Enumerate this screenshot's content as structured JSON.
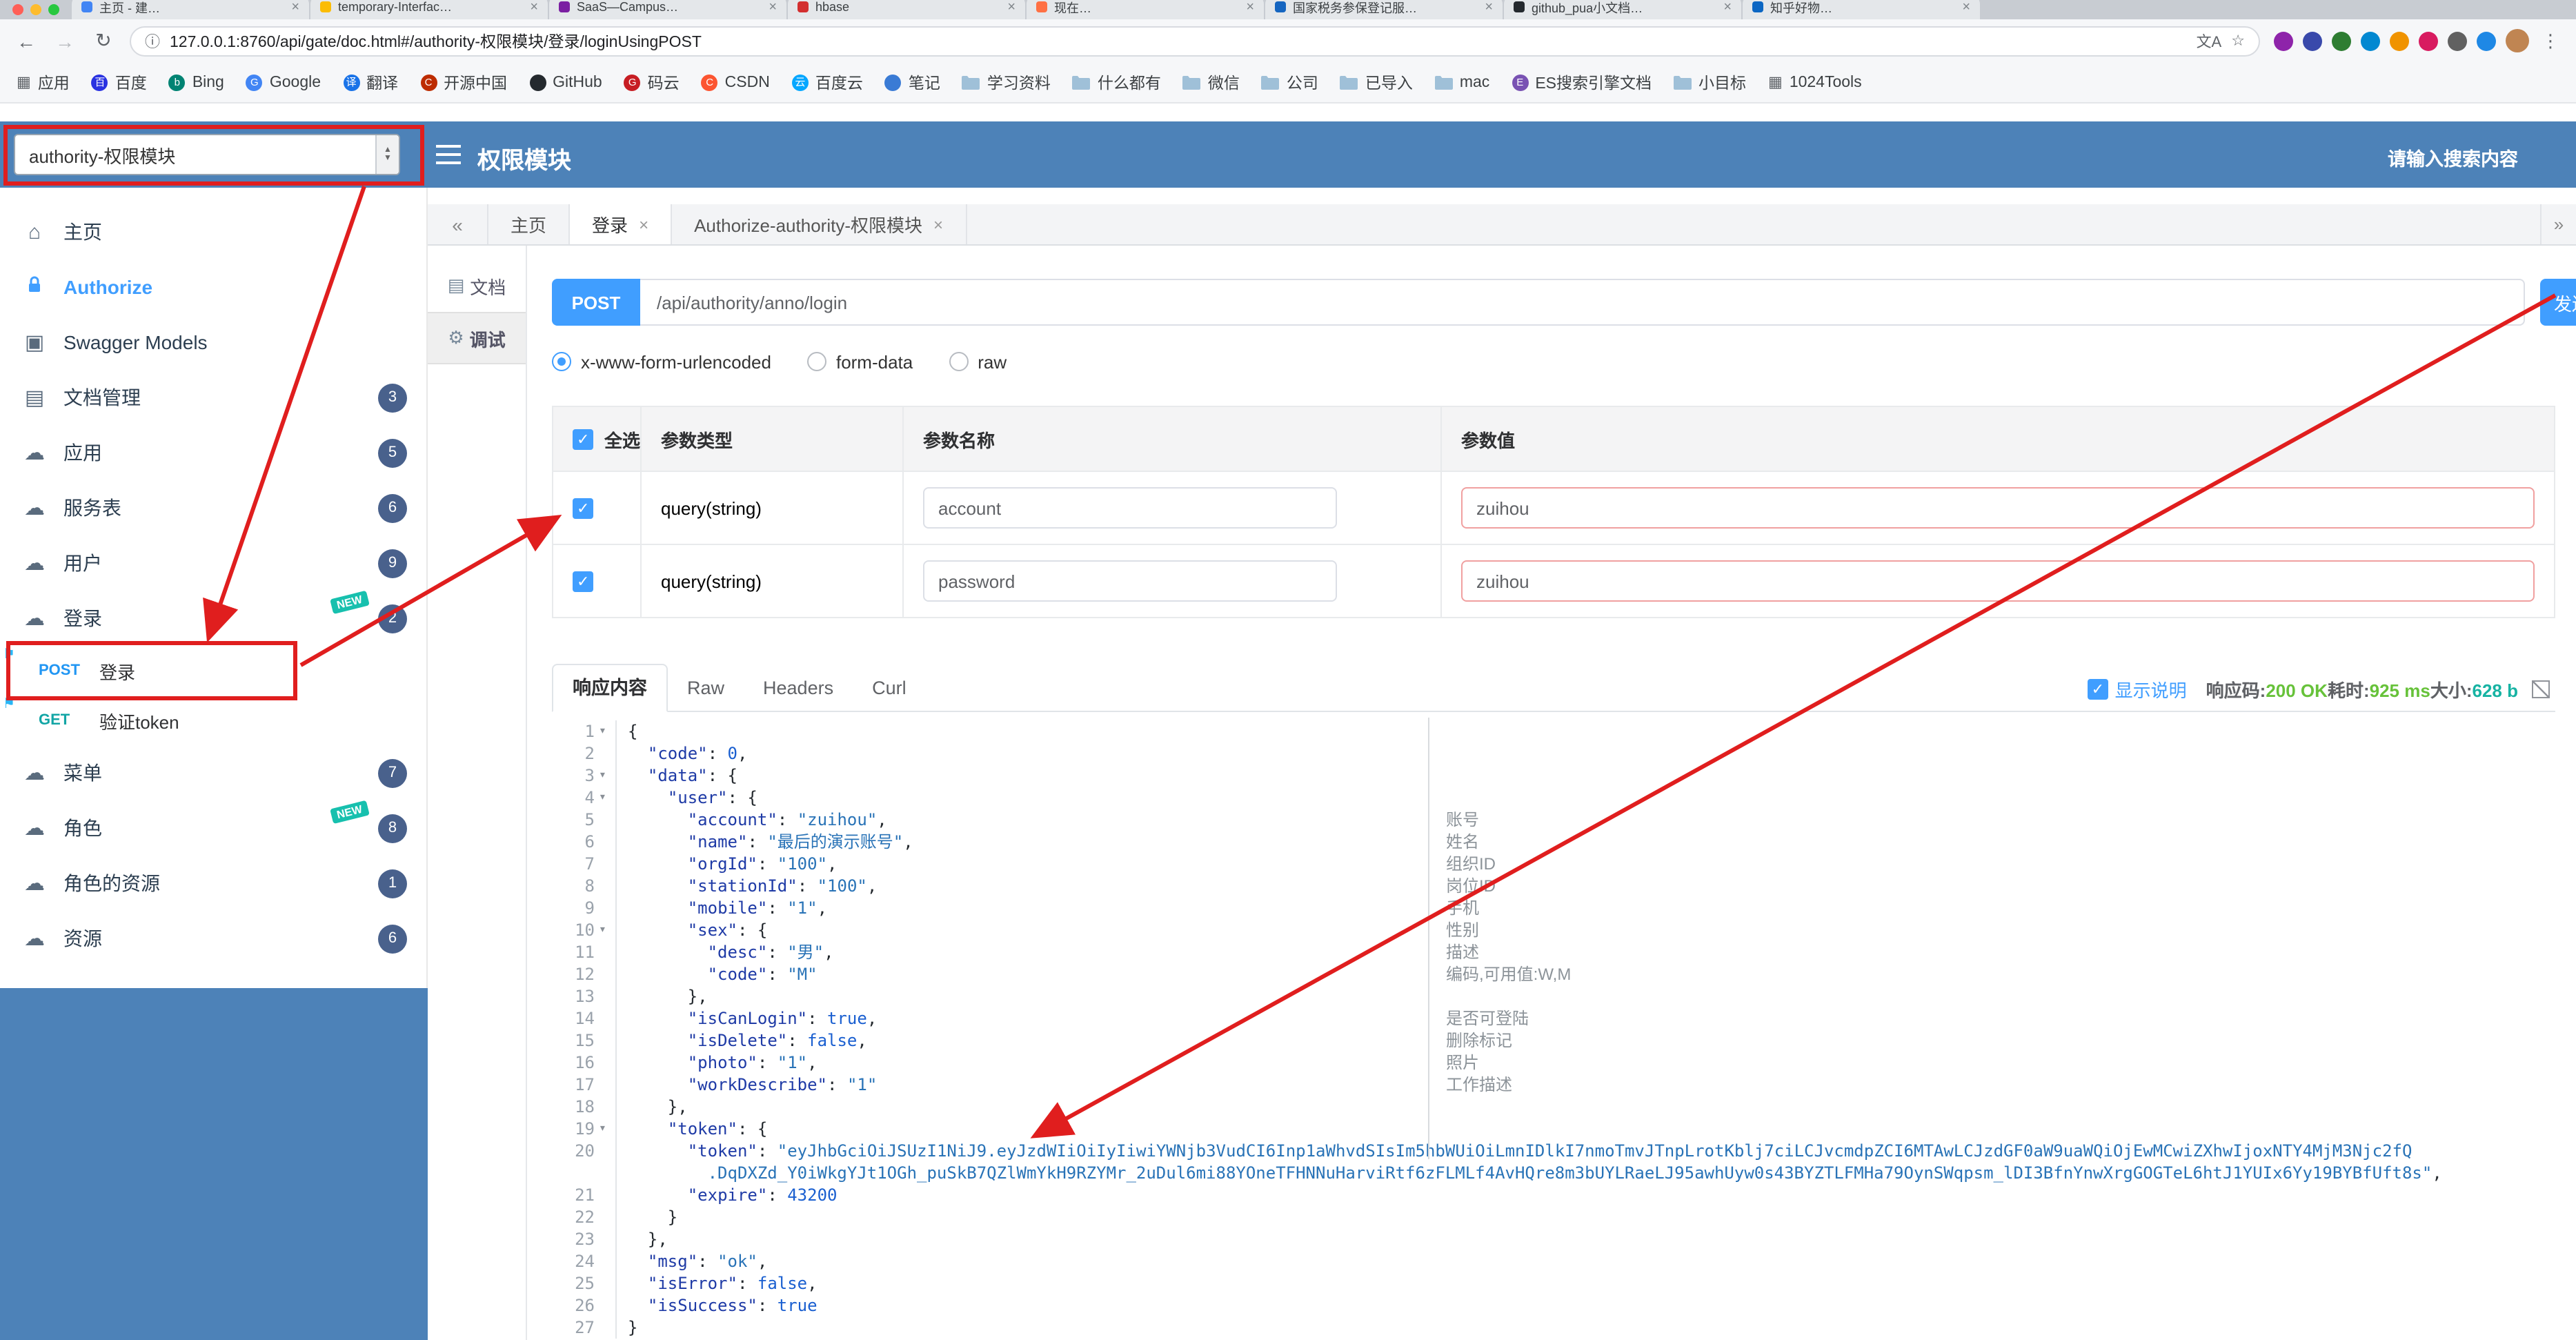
{
  "browser": {
    "traffic_lights": [
      "#ff5f57",
      "#febc2e",
      "#28c840"
    ],
    "tabs": [
      {
        "label": "主页 - 建…",
        "favicon": "#4285f4"
      },
      {
        "label": "temporary-Interfac…",
        "favicon": "#fbbc04"
      },
      {
        "label": "SaaS—Campus…",
        "favicon": "#7b1fa2"
      },
      {
        "label": "hbase",
        "favicon": "#d32f2f"
      },
      {
        "label": "现在…",
        "favicon": "#ff7043"
      },
      {
        "label": "国家税务参保登记服…",
        "favicon": "#1565c0"
      },
      {
        "label": "github_pua小文档…",
        "favicon": "#24292e"
      },
      {
        "label": "知乎好物…",
        "favicon": "#0b66c3"
      }
    ],
    "url": "127.0.0.1:8760/api/gate/doc.html#/authority-权限模块/登录/loginUsingPOST",
    "extensions": [
      {
        "name": "extension-icon",
        "color": "#8e24aa"
      },
      {
        "name": "extension-icon",
        "color": "#3949ab"
      },
      {
        "name": "extension-icon",
        "color": "#2e7d32"
      },
      {
        "name": "extension-icon",
        "color": "#0288d1"
      },
      {
        "name": "extension-icon",
        "color": "#f09300"
      },
      {
        "name": "extension-icon",
        "color": "#d81b60"
      },
      {
        "name": "extension-icon",
        "color": "#616161"
      },
      {
        "name": "extension-icon",
        "color": "#1e88e5"
      }
    ],
    "bookmarks": [
      {
        "label": "应用",
        "type": "apps"
      },
      {
        "label": "百度",
        "type": "site",
        "color": "#2932e1",
        "letter": "百"
      },
      {
        "label": "Bing",
        "type": "site",
        "color": "#008373",
        "letter": "b"
      },
      {
        "label": "Google",
        "type": "site",
        "color": "#4285f4",
        "letter": "G"
      },
      {
        "label": "翻译",
        "type": "site",
        "color": "#1a73e8",
        "letter": "译"
      },
      {
        "label": "开源中国",
        "type": "site",
        "color": "#bd2c00",
        "letter": "C"
      },
      {
        "label": "GitHub",
        "type": "site",
        "color": "#24292e",
        "letter": ""
      },
      {
        "label": "码云",
        "type": "site",
        "color": "#c71d23",
        "letter": "G"
      },
      {
        "label": "CSDN",
        "type": "site",
        "color": "#fc5531",
        "letter": "C"
      },
      {
        "label": "百度云",
        "type": "site",
        "color": "#06a7ff",
        "letter": "云"
      },
      {
        "label": "笔记",
        "type": "site",
        "color": "#3a7bd5",
        "letter": ""
      },
      {
        "label": "学习资料",
        "type": "folder"
      },
      {
        "label": "什么都有",
        "type": "folder"
      },
      {
        "label": "微信",
        "type": "folder"
      },
      {
        "label": "公司",
        "type": "folder"
      },
      {
        "label": "已导入",
        "type": "folder"
      },
      {
        "label": "mac",
        "type": "folder"
      },
      {
        "label": "ES搜索引擎文档",
        "type": "site",
        "color": "#7952b3",
        "letter": "E"
      },
      {
        "label": "小目标",
        "type": "folder"
      },
      {
        "label": "1024Tools",
        "type": "apps"
      }
    ]
  },
  "header": {
    "module_select": "authority-权限模块",
    "title": "权限模块",
    "search_placeholder": "请输入搜索内容"
  },
  "sidebar": {
    "items": [
      {
        "label": "主页",
        "icon": "home"
      },
      {
        "label": "Authorize",
        "icon": "lock"
      },
      {
        "label": "Swagger Models",
        "icon": "models"
      },
      {
        "label": "文档管理",
        "icon": "doc",
        "badge": "3"
      },
      {
        "label": "应用",
        "icon": "cloud",
        "badge": "5"
      },
      {
        "label": "服务表",
        "icon": "cloud",
        "badge": "6"
      },
      {
        "label": "用户",
        "icon": "cloud",
        "badge": "9"
      },
      {
        "label": "登录",
        "icon": "cloud",
        "badge": "2",
        "new": true
      },
      {
        "label": "菜单",
        "icon": "cloud",
        "badge": "7"
      },
      {
        "label": "角色",
        "icon": "cloud",
        "badge": "8",
        "new": true
      },
      {
        "label": "角色的资源",
        "icon": "cloud",
        "badge": "1"
      },
      {
        "label": "资源",
        "icon": "cloud",
        "badge": "6"
      }
    ],
    "sub_items": [
      {
        "method": "POST",
        "label": "登录"
      },
      {
        "method": "GET",
        "label": "验证token"
      }
    ]
  },
  "doc_tabs": {
    "collapse": "«",
    "expand": "»",
    "tabs": [
      {
        "label": "主页"
      },
      {
        "label": "登录"
      },
      {
        "label": "Authorize-authority-权限模块"
      }
    ]
  },
  "minitabs": {
    "doc": "文档",
    "debug": "调试"
  },
  "request": {
    "method": "POST",
    "url": "/api/authority/anno/login",
    "send_label": "发送",
    "content_types": [
      "x-www-form-urlencoded",
      "form-data",
      "raw"
    ],
    "selected_content_type": "x-www-form-urlencoded",
    "table": {
      "headers": [
        "全选",
        "参数类型",
        "参数名称",
        "参数值"
      ],
      "rows": [
        {
          "checked": true,
          "type": "query(string)",
          "name": "account",
          "value": "zuihou"
        },
        {
          "checked": true,
          "type": "query(string)",
          "name": "password",
          "value": "zuihou"
        }
      ]
    }
  },
  "response": {
    "tabs": [
      "响应内容",
      "Raw",
      "Headers",
      "Curl"
    ],
    "active_tab": "响应内容",
    "show_desc": "显示说明",
    "meta": [
      {
        "label": "响应码:",
        "value": "200 OK",
        "color": "#67c23a"
      },
      {
        "label": "耗时:",
        "value": "925 ms",
        "color": "#67c23a"
      },
      {
        "label": "大小:",
        "value": "628 b",
        "color": "#17b3a3"
      }
    ],
    "code_lines": [
      {
        "n": "1",
        "fold": true,
        "parts": [
          [
            "p",
            "{"
          ]
        ]
      },
      {
        "n": "2",
        "parts": [
          [
            "p",
            "  "
          ],
          [
            "k",
            "\"code\""
          ],
          [
            "p",
            ": "
          ],
          [
            "n",
            "0"
          ],
          [
            "p",
            ","
          ]
        ]
      },
      {
        "n": "3",
        "fold": true,
        "parts": [
          [
            "p",
            "  "
          ],
          [
            "k",
            "\"data\""
          ],
          [
            "p",
            ": {"
          ]
        ]
      },
      {
        "n": "4",
        "fold": true,
        "parts": [
          [
            "p",
            "    "
          ],
          [
            "k",
            "\"user\""
          ],
          [
            "p",
            ": {"
          ]
        ]
      },
      {
        "n": "5",
        "note": "账号",
        "parts": [
          [
            "p",
            "      "
          ],
          [
            "k",
            "\"account\""
          ],
          [
            "p",
            ": "
          ],
          [
            "s",
            "\"zuihou\""
          ],
          [
            "p",
            ","
          ]
        ]
      },
      {
        "n": "6",
        "note": "姓名",
        "parts": [
          [
            "p",
            "      "
          ],
          [
            "k",
            "\"name\""
          ],
          [
            "p",
            ": "
          ],
          [
            "s",
            "\"最后的演示账号\""
          ],
          [
            "p",
            ","
          ]
        ]
      },
      {
        "n": "7",
        "note": "组织ID",
        "parts": [
          [
            "p",
            "      "
          ],
          [
            "k",
            "\"orgId\""
          ],
          [
            "p",
            ": "
          ],
          [
            "s",
            "\"100\""
          ],
          [
            "p",
            ","
          ]
        ]
      },
      {
        "n": "8",
        "note": "岗位ID",
        "parts": [
          [
            "p",
            "      "
          ],
          [
            "k",
            "\"stationId\""
          ],
          [
            "p",
            ": "
          ],
          [
            "s",
            "\"100\""
          ],
          [
            "p",
            ","
          ]
        ]
      },
      {
        "n": "9",
        "note": "手机",
        "parts": [
          [
            "p",
            "      "
          ],
          [
            "k",
            "\"mobile\""
          ],
          [
            "p",
            ": "
          ],
          [
            "s",
            "\"1\""
          ],
          [
            "p",
            ","
          ]
        ]
      },
      {
        "n": "10",
        "fold": true,
        "note": "性别",
        "parts": [
          [
            "p",
            "      "
          ],
          [
            "k",
            "\"sex\""
          ],
          [
            "p",
            ": {"
          ]
        ]
      },
      {
        "n": "11",
        "note": "描述",
        "parts": [
          [
            "p",
            "        "
          ],
          [
            "k",
            "\"desc\""
          ],
          [
            "p",
            ": "
          ],
          [
            "s",
            "\"男\""
          ],
          [
            "p",
            ","
          ]
        ]
      },
      {
        "n": "12",
        "note": "编码,可用值:W,M",
        "parts": [
          [
            "p",
            "        "
          ],
          [
            "k",
            "\"code\""
          ],
          [
            "p",
            ": "
          ],
          [
            "s",
            "\"M\""
          ]
        ]
      },
      {
        "n": "13",
        "parts": [
          [
            "p",
            "      },"
          ]
        ]
      },
      {
        "n": "14",
        "note": "是否可登陆",
        "parts": [
          [
            "p",
            "      "
          ],
          [
            "k",
            "\"isCanLogin\""
          ],
          [
            "p",
            ": "
          ],
          [
            "n",
            "true"
          ],
          [
            "p",
            ","
          ]
        ]
      },
      {
        "n": "15",
        "note": "删除标记",
        "parts": [
          [
            "p",
            "      "
          ],
          [
            "k",
            "\"isDelete\""
          ],
          [
            "p",
            ": "
          ],
          [
            "n",
            "false"
          ],
          [
            "p",
            ","
          ]
        ]
      },
      {
        "n": "16",
        "note": "照片",
        "parts": [
          [
            "p",
            "      "
          ],
          [
            "k",
            "\"photo\""
          ],
          [
            "p",
            ": "
          ],
          [
            "s",
            "\"1\""
          ],
          [
            "p",
            ","
          ]
        ]
      },
      {
        "n": "17",
        "note": "工作描述",
        "parts": [
          [
            "p",
            "      "
          ],
          [
            "k",
            "\"workDescribe\""
          ],
          [
            "p",
            ": "
          ],
          [
            "s",
            "\"1\""
          ]
        ]
      },
      {
        "n": "18",
        "parts": [
          [
            "p",
            "    },"
          ]
        ]
      },
      {
        "n": "19",
        "fold": true,
        "parts": [
          [
            "p",
            "    "
          ],
          [
            "k",
            "\"token\""
          ],
          [
            "p",
            ": {"
          ]
        ]
      },
      {
        "n": "20",
        "parts": [
          [
            "p",
            "      "
          ],
          [
            "k",
            "\"token\""
          ],
          [
            "p",
            ": "
          ],
          [
            "s",
            "\"eyJhbGciOiJSUzI1NiJ9.eyJzdWIiOiIyIiwiYWNjb3VudCI6Inp1aWhvdSIsIm5hbWUiOiLmnIDlkI7nmoTmvJTnpLrotKblj7ciLCJvcmdpZCI6MTAwLCJzdGF0aW9uaWQiOjEwMCwiZXhwIjoxNTY4MjM3Njc2fQ"
          ]
        ]
      },
      {
        "n": "",
        "parts": [
          [
            "s",
            "        .DqDXZd_Y0iWkgYJt1OGh_puSkB7QZlWmYkH9RZYMr_2uDul6mi88YOneTFHNNuHarviRtf6zFLMLf4AvHQre8m3bUYLRaeLJ95awhUyw0s43BYZTLFMHa79OynSWqpsm_lDI3BfnYnwXrgGOGTeL6htJ1YUIx6Yy19BYBfUft8s\""
          ],
          [
            "p",
            ","
          ]
        ]
      },
      {
        "n": "21",
        "parts": [
          [
            "p",
            "      "
          ],
          [
            "k",
            "\"expire\""
          ],
          [
            "p",
            ": "
          ],
          [
            "n",
            "43200"
          ]
        ]
      },
      {
        "n": "22",
        "parts": [
          [
            "p",
            "    }"
          ]
        ]
      },
      {
        "n": "23",
        "parts": [
          [
            "p",
            "  },"
          ]
        ]
      },
      {
        "n": "24",
        "parts": [
          [
            "p",
            "  "
          ],
          [
            "k",
            "\"msg\""
          ],
          [
            "p",
            ": "
          ],
          [
            "s",
            "\"ok\""
          ],
          [
            "p",
            ","
          ]
        ]
      },
      {
        "n": "25",
        "parts": [
          [
            "p",
            "  "
          ],
          [
            "k",
            "\"isError\""
          ],
          [
            "p",
            ": "
          ],
          [
            "n",
            "false"
          ],
          [
            "p",
            ","
          ]
        ]
      },
      {
        "n": "26",
        "parts": [
          [
            "p",
            "  "
          ],
          [
            "k",
            "\"isSuccess\""
          ],
          [
            "p",
            ": "
          ],
          [
            "n",
            "true"
          ]
        ]
      },
      {
        "n": "27",
        "parts": [
          [
            "p",
            "}"
          ]
        ]
      }
    ]
  },
  "annotations": {
    "color": "#e01e1e"
  }
}
